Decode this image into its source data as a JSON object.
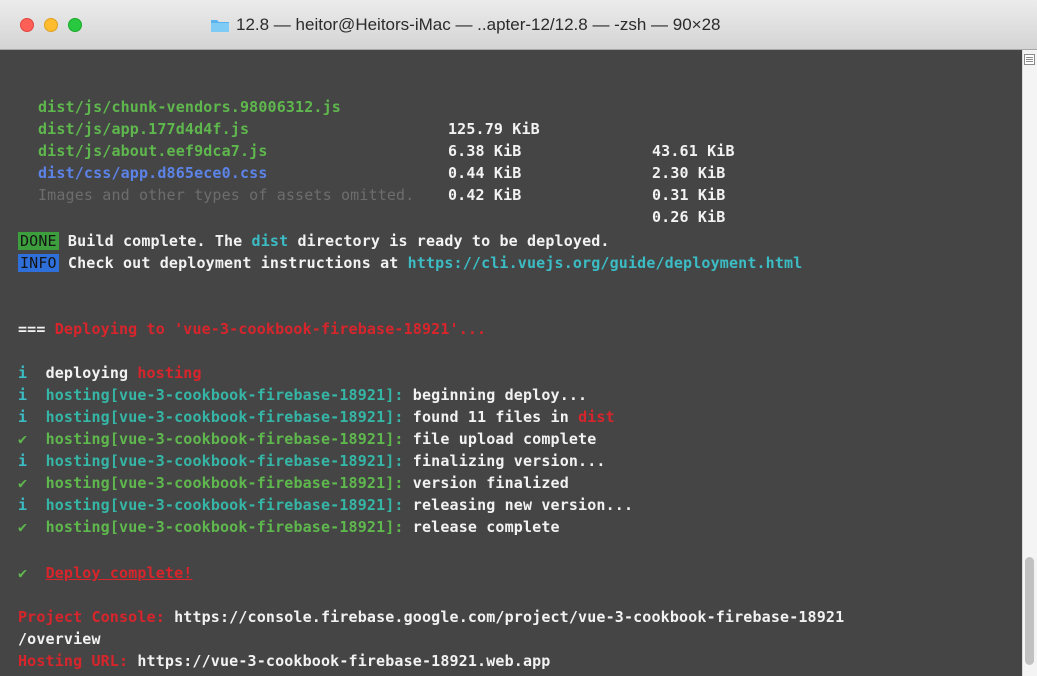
{
  "window": {
    "title": "12.8 — heitor@Heitors-iMac — ..apter-12/12.8 — -zsh — 90×28"
  },
  "icons": {
    "folder": "folder-icon",
    "resize": "split-pane-icon",
    "close": "close-light",
    "minimize": "minimize-light",
    "zoom": "zoom-light"
  },
  "colors": {
    "terminal_bg": "#454545",
    "green": "#5fb84d",
    "blue": "#5c83e8",
    "red": "#d8252c",
    "cyan": "#3cbcc4",
    "done_badge": "#3c9e3c",
    "info_badge": "#2e6fd9"
  },
  "assets": [
    {
      "file": "dist/js/chunk-vendors.98006312.js",
      "size": "125.79 KiB",
      "gzipped": "43.61 KiB"
    },
    {
      "file": "dist/js/app.177d4d4f.js",
      "size": "6.38 KiB",
      "gzipped": "2.30 KiB"
    },
    {
      "file": "dist/js/about.eef9dca7.js",
      "size": "0.44 KiB",
      "gzipped": "0.31 KiB"
    },
    {
      "file": "dist/css/app.d865ece0.css",
      "size": "0.42 KiB",
      "gzipped": "0.26 KiB"
    }
  ],
  "omitted_note": "Images and other types of assets omitted.",
  "done": {
    "badge": "DONE",
    "text_before": "Build complete. The ",
    "highlight": "dist",
    "text_after": " directory is ready to be deployed."
  },
  "info": {
    "badge": "INFO",
    "text": "Check out deployment instructions at ",
    "url": "https://cli.vuejs.org/guide/deployment.html"
  },
  "deploy_header": {
    "prefix": "===",
    "text": "Deploying to 'vue-3-cookbook-firebase-18921'..."
  },
  "deploying": {
    "marker": "i",
    "text": "deploying ",
    "highlight": "hosting"
  },
  "hosting_label": "hosting[vue-3-cookbook-firebase-18921]:",
  "steps": [
    {
      "marker": "i",
      "msg": " beginning deploy...",
      "extra": ""
    },
    {
      "marker": "i",
      "msg": " found 11 files in ",
      "extra": "dist"
    },
    {
      "marker": "✔",
      "msg": " file upload complete",
      "extra": ""
    },
    {
      "marker": "i",
      "msg": " finalizing version...",
      "extra": ""
    },
    {
      "marker": "✔",
      "msg": " version finalized",
      "extra": ""
    },
    {
      "marker": "i",
      "msg": " releasing new version...",
      "extra": ""
    },
    {
      "marker": "✔",
      "msg": " release complete",
      "extra": ""
    }
  ],
  "complete": {
    "marker": "✔",
    "text": "Deploy complete!"
  },
  "console": {
    "label": "Project Console:",
    "url": " https://console.firebase.google.com/project/vue-3-cookbook-firebase-18921",
    "url_wrap": "/overview"
  },
  "hosting_url": {
    "label": "Hosting URL:",
    "url": " https://vue-3-cookbook-firebase-18921.web.app"
  }
}
